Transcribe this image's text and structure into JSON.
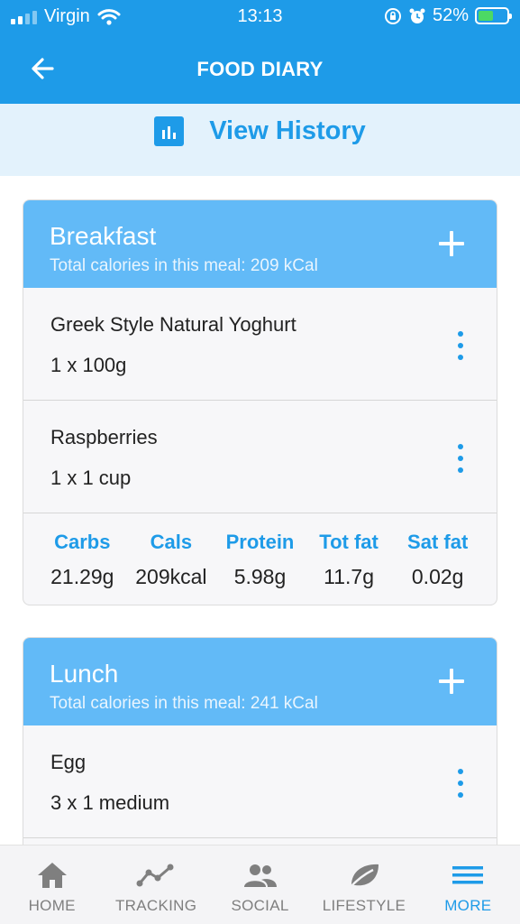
{
  "status_bar": {
    "carrier": "Virgin",
    "time": "13:13",
    "battery": "52%"
  },
  "header": {
    "title": "FOOD DIARY",
    "back_icon": "back-arrow-icon"
  },
  "history": {
    "label": "View History",
    "icon": "bar-chart-icon"
  },
  "meals": [
    {
      "name": "Breakfast",
      "calories_text": "Total calories in this meal: 209 kCal",
      "items": [
        {
          "name": "Greek Style Natural Yoghurt",
          "quantity": "1 x 100g"
        },
        {
          "name": "Raspberries",
          "quantity": "1 x 1 cup"
        }
      ],
      "nutrition": [
        {
          "label": "Carbs",
          "value": "21.29g"
        },
        {
          "label": "Cals",
          "value": "209kcal"
        },
        {
          "label": "Protein",
          "value": "5.98g"
        },
        {
          "label": "Tot fat",
          "value": "11.7g"
        },
        {
          "label": "Sat fat",
          "value": "0.02g"
        }
      ]
    },
    {
      "name": "Lunch",
      "calories_text": "Total calories in this meal: 241 kCal",
      "items": [
        {
          "name": "Egg",
          "quantity": "3 x 1 medium"
        }
      ]
    }
  ],
  "tabs": [
    {
      "label": "HOME",
      "icon": "home-icon",
      "active": false
    },
    {
      "label": "TRACKING",
      "icon": "trend-line-icon",
      "active": false
    },
    {
      "label": "SOCIAL",
      "icon": "people-icon",
      "active": false
    },
    {
      "label": "LIFESTYLE",
      "icon": "leaf-icon",
      "active": false
    },
    {
      "label": "MORE",
      "icon": "menu-icon",
      "active": true
    }
  ],
  "colors": {
    "primary": "#1e9be8",
    "meal_header": "#62baf7",
    "history_bg": "#e3f2fc",
    "card_bg": "#f7f7f9",
    "tab_inactive": "#7f7f7f"
  }
}
